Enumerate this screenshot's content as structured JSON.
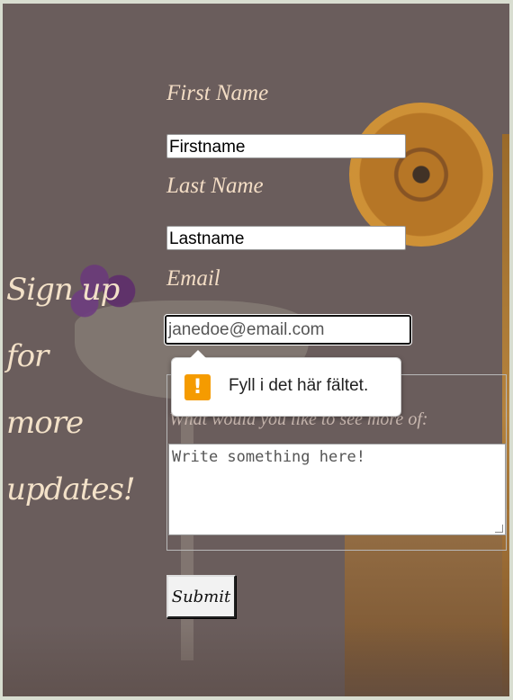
{
  "heading": {
    "line1": "Sign up for",
    "line2": "more",
    "line3": "updates!"
  },
  "form": {
    "first_name_label": "First Name",
    "first_name_value": "Firstname",
    "last_name_label": "Last Name",
    "last_name_value": "Lastname",
    "email_label": "Email",
    "email_placeholder": "janedoe@email.com",
    "question_label": "What would you like to see more of:",
    "textarea_placeholder": "Write something here!",
    "submit_label": "Submit"
  },
  "validation_tooltip": {
    "icon": "warning-icon",
    "message": "Fyll i det här fältet."
  },
  "colors": {
    "overlay": "#6a5d5c",
    "label_text": "#f2dcc4",
    "warning": "#f59b00"
  }
}
